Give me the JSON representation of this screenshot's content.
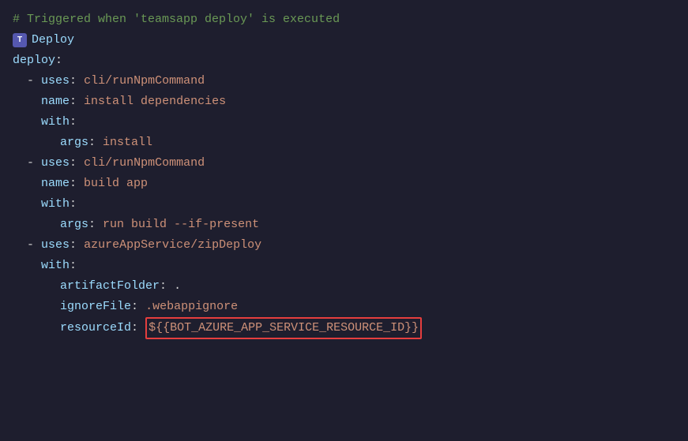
{
  "colors": {
    "background": "#1e1e2e",
    "comment": "#6a9955",
    "keyword": "#569cd6",
    "key": "#9cdcfe",
    "string": "#ce9178",
    "plain": "#d4d4d4",
    "highlight_border": "#e53e3e"
  },
  "lines": [
    {
      "id": "comment",
      "text": "# Triggered when 'teamsapp deploy' is executed"
    },
    {
      "id": "deploy-icon-line",
      "icon": "T",
      "label": "Deploy"
    },
    {
      "id": "deploy-key",
      "text": "deploy:"
    },
    {
      "id": "uses1",
      "indent": "  ",
      "dash": "- ",
      "key": "uses",
      "colon": ": ",
      "value": "cli/runNpmCommand"
    },
    {
      "id": "name1",
      "indent": "    ",
      "key": "name",
      "colon": ": ",
      "value": "install dependencies"
    },
    {
      "id": "with1",
      "indent": "    ",
      "key": "with",
      "colon": ":"
    },
    {
      "id": "bar1",
      "indent": "    ",
      "bar": true,
      "key": "  args",
      "colon": ": ",
      "value": "install"
    },
    {
      "id": "uses2",
      "indent": "  ",
      "dash": "- ",
      "key": "uses",
      "colon": ": ",
      "value": "cli/runNpmCommand"
    },
    {
      "id": "name2",
      "indent": "    ",
      "key": "name",
      "colon": ": ",
      "value": "build app"
    },
    {
      "id": "with2",
      "indent": "    ",
      "key": "with",
      "colon": ":"
    },
    {
      "id": "bar2",
      "indent": "    ",
      "bar": true,
      "key": "  args",
      "colon": ": ",
      "value": "run build --if-present"
    },
    {
      "id": "uses3",
      "indent": "  ",
      "dash": "- ",
      "key": "uses",
      "colon": ": ",
      "value": "azureAppService/zipDeploy"
    },
    {
      "id": "with3",
      "indent": "    ",
      "key": "with",
      "colon": ":"
    },
    {
      "id": "artifact",
      "indent": "    ",
      "bar": true,
      "key": "  artifactFolder",
      "colon": ": ",
      "value": "."
    },
    {
      "id": "ignorefile",
      "indent": "    ",
      "bar": true,
      "key": "  ignoreFile",
      "colon": ": ",
      "value": ".webappignore"
    },
    {
      "id": "resourceid",
      "indent": "    ",
      "bar": true,
      "key": "  resourceId",
      "colon": ": ",
      "value": "${{BOT_AZURE_APP_SERVICE_RESOURCE_ID}}",
      "highlighted": true
    }
  ]
}
